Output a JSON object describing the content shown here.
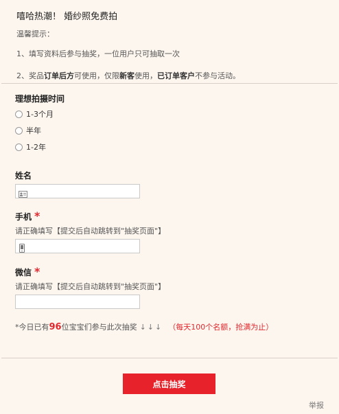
{
  "header": {
    "title": "嘻哈热潮！ 婚纱照免费拍",
    "tip_label": "温馨提示：",
    "rule1": "1、填写资料后参与抽奖，一位用户只可抽取一次",
    "rule2_parts": [
      "2、奖品",
      "订单后方",
      "可使用，仅限",
      "新客",
      "使用，",
      "已订单客户",
      "不参与活动。"
    ]
  },
  "form": {
    "time_label": "理想拍摄时间",
    "time_options": [
      "1-3个月",
      "半年",
      "1-2年"
    ],
    "name_label": "姓名",
    "phone_label": "手机",
    "phone_required": "*",
    "phone_hint": "请正确填写【提交后自动跳转到\"抽奖页面\"】",
    "wechat_label": "微信",
    "wechat_required": "*",
    "wechat_hint": "请正确填写【提交后自动跳转到\"抽奖页面\"】"
  },
  "notice": {
    "prefix": "*今日已有",
    "count": "96",
    "suffix": "位宝宝们参与此次抽奖",
    "arrows": "↓↓↓",
    "quota": "（每天100个名额，抢满为止）"
  },
  "submit_label": "点击抽奖",
  "report_label": "举报",
  "colors": {
    "accent": "#e7222a",
    "background": "#fdf6ef"
  }
}
